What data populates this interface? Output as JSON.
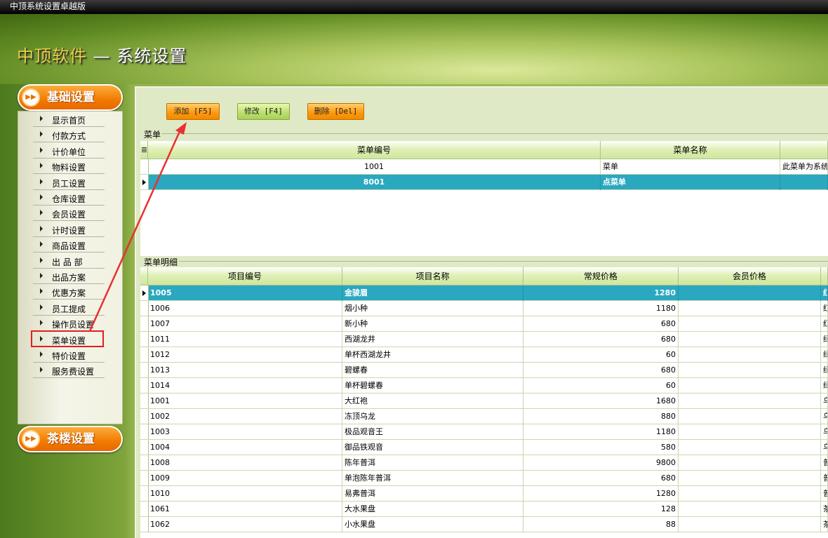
{
  "window": {
    "title": "中顶系统设置卓越版"
  },
  "header": {
    "brand": "中顶软件",
    "separator": " — ",
    "subtitle": "系统设置"
  },
  "sidebar": {
    "section1": "基础设置",
    "section2": "茶楼设置",
    "items": [
      "显示首页",
      "付款方式",
      "计价单位",
      "物料设置",
      "员工设置",
      "仓库设置",
      "会员设置",
      "计时设置",
      "商品设置",
      "出 品 部",
      "出品方案",
      "优惠方案",
      "员工提成",
      "操作员设置",
      "菜单设置",
      "特价设置",
      "服务费设置"
    ],
    "selected": "菜单设置"
  },
  "toolbar": {
    "add": "添加 [F5]",
    "edit": "修改 [F4]",
    "delete": "删除 [Del]"
  },
  "menu_group": {
    "label": "菜单",
    "columns": [
      "菜单编号",
      "菜单名称"
    ],
    "rows": [
      {
        "code": "1001",
        "name": "菜单",
        "note": "此菜单为系统"
      },
      {
        "code": "8001",
        "name": "点菜单",
        "note": ""
      }
    ]
  },
  "detail_group": {
    "label": "菜单明细",
    "columns": [
      "项目编号",
      "项目名称",
      "常规价格",
      "会员价格"
    ],
    "rows": [
      {
        "code": "1005",
        "name": "金骏眉",
        "price": "1280",
        "member": "",
        "extra": "红"
      },
      {
        "code": "1006",
        "name": "烟小种",
        "price": "1180",
        "member": "",
        "extra": "红"
      },
      {
        "code": "1007",
        "name": "新小种",
        "price": "680",
        "member": "",
        "extra": "红"
      },
      {
        "code": "1011",
        "name": "西湖龙井",
        "price": "680",
        "member": "",
        "extra": "绿"
      },
      {
        "code": "1012",
        "name": "单杯西湖龙井",
        "price": "60",
        "member": "",
        "extra": "绿"
      },
      {
        "code": "1013",
        "name": "碧螺春",
        "price": "680",
        "member": "",
        "extra": "绿"
      },
      {
        "code": "1014",
        "name": "单杯碧螺春",
        "price": "60",
        "member": "",
        "extra": "绿"
      },
      {
        "code": "1001",
        "name": "大红袍",
        "price": "1680",
        "member": "",
        "extra": "乌"
      },
      {
        "code": "1002",
        "name": "冻顶乌龙",
        "price": "880",
        "member": "",
        "extra": "乌"
      },
      {
        "code": "1003",
        "name": "极品观音王",
        "price": "1180",
        "member": "",
        "extra": "乌"
      },
      {
        "code": "1004",
        "name": "御品铁观音",
        "price": "580",
        "member": "",
        "extra": "乌"
      },
      {
        "code": "1008",
        "name": "陈年普洱",
        "price": "9800",
        "member": "",
        "extra": "普"
      },
      {
        "code": "1009",
        "name": "单泡陈年普洱",
        "price": "680",
        "member": "",
        "extra": "普"
      },
      {
        "code": "1010",
        "name": "易弗普洱",
        "price": "1280",
        "member": "",
        "extra": "普"
      },
      {
        "code": "1061",
        "name": "大水果盘",
        "price": "128",
        "member": "",
        "extra": "茶"
      },
      {
        "code": "1062",
        "name": "小水果盘",
        "price": "88",
        "member": "",
        "extra": "茶"
      }
    ]
  },
  "colors": {
    "accent_orange": "#f07a00",
    "selection": "#2aa8c0",
    "annotation_red": "#e02020"
  }
}
